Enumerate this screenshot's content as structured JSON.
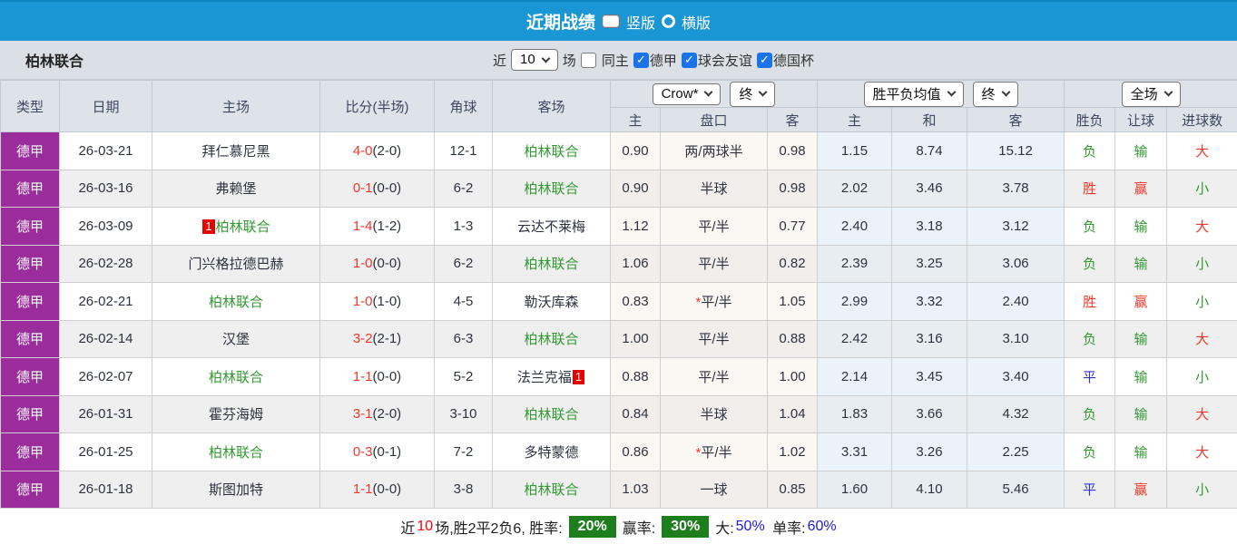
{
  "header": {
    "title": "近期战绩",
    "radio_vertical": "竖版",
    "radio_horizontal": "横版"
  },
  "toolbar": {
    "team": "柏林联合",
    "near_label": "近",
    "matches_value": "10",
    "matches_label": "场",
    "checkboxes": [
      {
        "label": "同主",
        "checked": false
      },
      {
        "label": "德甲",
        "checked": true
      },
      {
        "label": "球会友谊",
        "checked": true
      },
      {
        "label": "德国杯",
        "checked": true
      }
    ]
  },
  "table": {
    "left_headers": [
      "类型",
      "日期",
      "主场",
      "比分(半场)",
      "角球",
      "客场"
    ],
    "selects": {
      "odds_source": "Crow*",
      "odds_time": "终",
      "avg_type": "胜平负均值",
      "avg_time": "终",
      "scope": "全场"
    },
    "sub_headers": [
      "主",
      "盘口",
      "客",
      "主",
      "和",
      "客",
      "胜负",
      "让球",
      "进球数"
    ],
    "rows": [
      {
        "league": "德甲",
        "date": "26-03-21",
        "home": "拜仁慕尼黑",
        "home_color": "black",
        "home_badge": null,
        "score": "4-0",
        "half": "(2-0)",
        "corner": "12-1",
        "away": "柏林联合",
        "away_color": "green",
        "away_badge": null,
        "odds_home": "0.90",
        "handicap": "两/两球半",
        "star": false,
        "odds_away": "0.98",
        "avg_home": "1.15",
        "avg_draw": "8.74",
        "avg_away": "15.12",
        "result": "负",
        "result_color": "green",
        "let_result": "输",
        "let_color": "green",
        "goal_result": "大",
        "goal_color": "red"
      },
      {
        "league": "德甲",
        "date": "26-03-16",
        "home": "弗赖堡",
        "home_color": "black",
        "home_badge": null,
        "score": "0-1",
        "half": "(0-0)",
        "corner": "6-2",
        "away": "柏林联合",
        "away_color": "green",
        "away_badge": null,
        "odds_home": "0.90",
        "handicap": "半球",
        "star": false,
        "odds_away": "0.98",
        "avg_home": "2.02",
        "avg_draw": "3.46",
        "avg_away": "3.78",
        "result": "胜",
        "result_color": "red",
        "let_result": "赢",
        "let_color": "red",
        "goal_result": "小",
        "goal_color": "green"
      },
      {
        "league": "德甲",
        "date": "26-03-09",
        "home": "柏林联合",
        "home_color": "green",
        "home_badge": "1",
        "score": "1-4",
        "half": "(1-2)",
        "corner": "1-3",
        "away": "云达不莱梅",
        "away_color": "black",
        "away_badge": null,
        "odds_home": "1.12",
        "handicap": "平/半",
        "star": false,
        "odds_away": "0.77",
        "avg_home": "2.40",
        "avg_draw": "3.18",
        "avg_away": "3.12",
        "result": "负",
        "result_color": "green",
        "let_result": "输",
        "let_color": "green",
        "goal_result": "大",
        "goal_color": "red"
      },
      {
        "league": "德甲",
        "date": "26-02-28",
        "home": "门兴格拉德巴赫",
        "home_color": "black",
        "home_badge": null,
        "score": "1-0",
        "half": "(0-0)",
        "corner": "6-2",
        "away": "柏林联合",
        "away_color": "green",
        "away_badge": null,
        "odds_home": "1.06",
        "handicap": "平/半",
        "star": false,
        "odds_away": "0.82",
        "avg_home": "2.39",
        "avg_draw": "3.25",
        "avg_away": "3.06",
        "result": "负",
        "result_color": "green",
        "let_result": "输",
        "let_color": "green",
        "goal_result": "小",
        "goal_color": "green"
      },
      {
        "league": "德甲",
        "date": "26-02-21",
        "home": "柏林联合",
        "home_color": "green",
        "home_badge": null,
        "score": "1-0",
        "half": "(1-0)",
        "corner": "4-5",
        "away": "勒沃库森",
        "away_color": "black",
        "away_badge": null,
        "odds_home": "0.83",
        "handicap": "平/半",
        "star": true,
        "odds_away": "1.05",
        "avg_home": "2.99",
        "avg_draw": "3.32",
        "avg_away": "2.40",
        "result": "胜",
        "result_color": "red",
        "let_result": "赢",
        "let_color": "red",
        "goal_result": "小",
        "goal_color": "green"
      },
      {
        "league": "德甲",
        "date": "26-02-14",
        "home": "汉堡",
        "home_color": "black",
        "home_badge": null,
        "score": "3-2",
        "half": "(2-1)",
        "corner": "6-3",
        "away": "柏林联合",
        "away_color": "green",
        "away_badge": null,
        "odds_home": "1.00",
        "handicap": "平/半",
        "star": false,
        "odds_away": "0.88",
        "avg_home": "2.42",
        "avg_draw": "3.16",
        "avg_away": "3.10",
        "result": "负",
        "result_color": "green",
        "let_result": "输",
        "let_color": "green",
        "goal_result": "大",
        "goal_color": "red"
      },
      {
        "league": "德甲",
        "date": "26-02-07",
        "home": "柏林联合",
        "home_color": "green",
        "home_badge": null,
        "score": "1-1",
        "half": "(0-0)",
        "corner": "5-2",
        "away": "法兰克福",
        "away_color": "black",
        "away_badge": "1",
        "odds_home": "0.88",
        "handicap": "平/半",
        "star": false,
        "odds_away": "1.00",
        "avg_home": "2.14",
        "avg_draw": "3.45",
        "avg_away": "3.40",
        "result": "平",
        "result_color": "blue",
        "let_result": "输",
        "let_color": "green",
        "goal_result": "小",
        "goal_color": "green"
      },
      {
        "league": "德甲",
        "date": "26-01-31",
        "home": "霍芬海姆",
        "home_color": "black",
        "home_badge": null,
        "score": "3-1",
        "half": "(2-0)",
        "corner": "3-10",
        "away": "柏林联合",
        "away_color": "green",
        "away_badge": null,
        "odds_home": "0.84",
        "handicap": "半球",
        "star": false,
        "odds_away": "1.04",
        "avg_home": "1.83",
        "avg_draw": "3.66",
        "avg_away": "4.32",
        "result": "负",
        "result_color": "green",
        "let_result": "输",
        "let_color": "green",
        "goal_result": "大",
        "goal_color": "red"
      },
      {
        "league": "德甲",
        "date": "26-01-25",
        "home": "柏林联合",
        "home_color": "green",
        "home_badge": null,
        "score": "0-3",
        "half": "(0-1)",
        "corner": "7-2",
        "away": "多特蒙德",
        "away_color": "black",
        "away_badge": null,
        "odds_home": "0.86",
        "handicap": "平/半",
        "star": true,
        "odds_away": "1.02",
        "avg_home": "3.31",
        "avg_draw": "3.26",
        "avg_away": "2.25",
        "result": "负",
        "result_color": "green",
        "let_result": "输",
        "let_color": "green",
        "goal_result": "大",
        "goal_color": "red"
      },
      {
        "league": "德甲",
        "date": "26-01-18",
        "home": "斯图加特",
        "home_color": "black",
        "home_badge": null,
        "score": "1-1",
        "half": "(0-0)",
        "corner": "3-8",
        "away": "柏林联合",
        "away_color": "green",
        "away_badge": null,
        "odds_home": "1.03",
        "handicap": "一球",
        "star": false,
        "odds_away": "0.85",
        "avg_home": "1.60",
        "avg_draw": "4.10",
        "avg_away": "5.46",
        "result": "平",
        "result_color": "blue",
        "let_result": "赢",
        "let_color": "red",
        "goal_result": "小",
        "goal_color": "green"
      }
    ]
  },
  "summary": {
    "near_label": "近",
    "count": "10",
    "record_text": "场,胜2平2负6, 胜率:",
    "win_rate": "20%",
    "odds_win_label": "赢率:",
    "odds_win_rate": "30%",
    "big_label": "大:",
    "big_rate": "50%",
    "single_label": "单率:",
    "single_rate": "60%"
  },
  "colors": {
    "topbar_blue": "#1996d3",
    "league_purple": "#9a2c9c",
    "win_red": "#f0392b",
    "lose_green": "#339933",
    "draw_blue": "#3333cc",
    "badge_green": "#1e7e1e",
    "checkbox_blue": "#1a73e8",
    "avg_col_blue": "#eaf3fa"
  }
}
